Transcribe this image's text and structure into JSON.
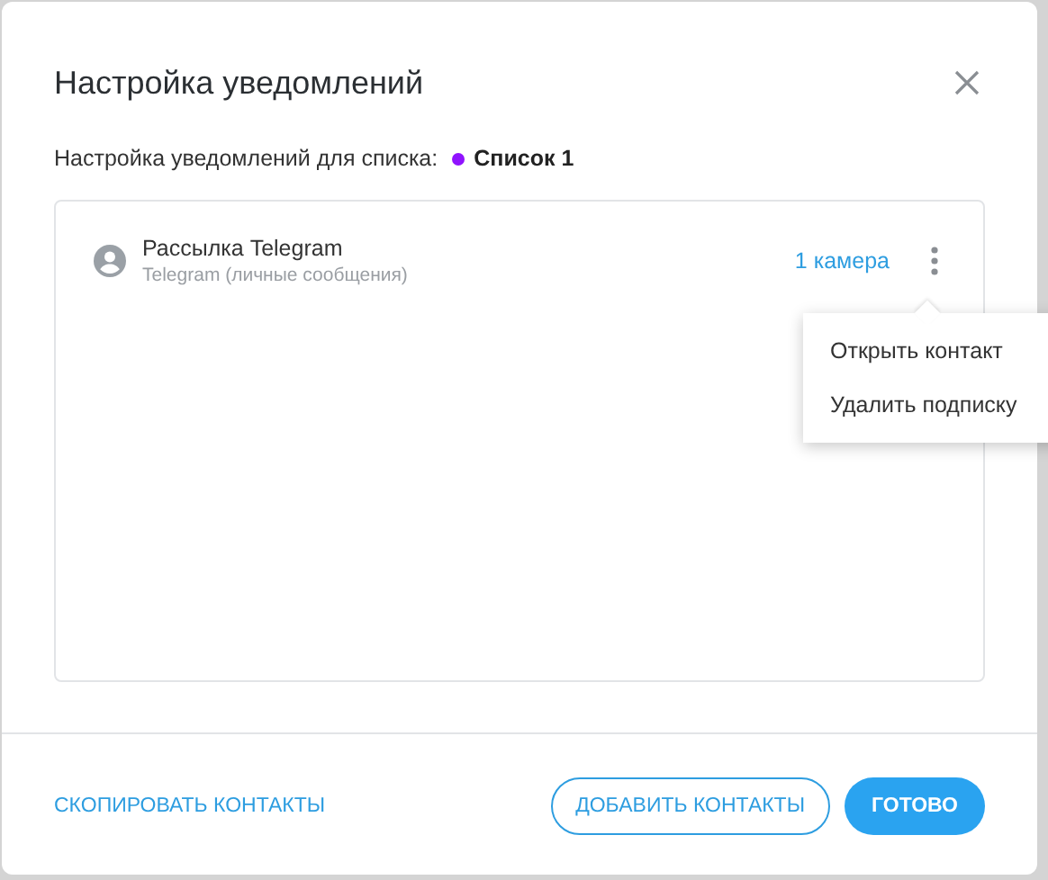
{
  "dialog": {
    "title": "Настройка уведомлений",
    "subtitle": {
      "label": "Настройка уведомлений для списка:",
      "list_name": "Список 1",
      "color": "#9013fe"
    }
  },
  "subscriptions": [
    {
      "name": "Рассылка Telegram",
      "channel": "Telegram (личные сообщения)",
      "cameras": "1 камера",
      "menu_open": true
    }
  ],
  "context_menu": [
    "Открыть контакт",
    "Удалить подписку"
  ],
  "footer": {
    "copy_link": "СКОПИРОВАТЬ КОНТАКТЫ",
    "add_button": "ДОБАВИТЬ КОНТАКТЫ",
    "done_button": "ГОТОВО"
  }
}
